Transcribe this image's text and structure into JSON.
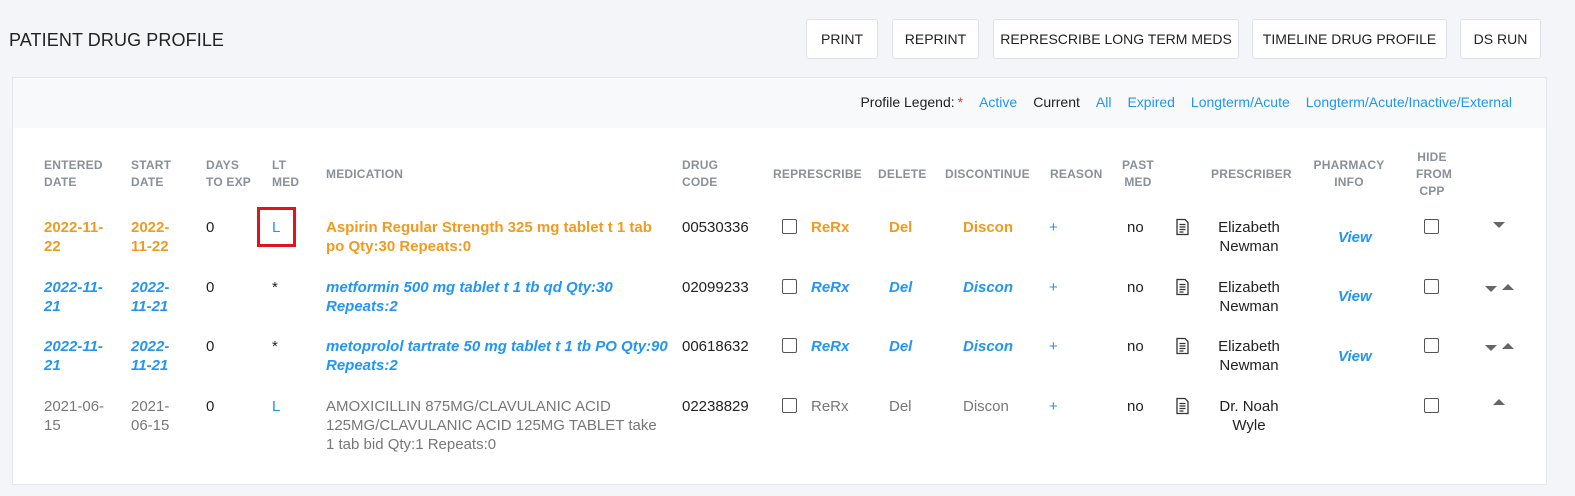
{
  "page": {
    "title": "PATIENT DRUG PROFILE"
  },
  "toolbar": {
    "print": "PRINT",
    "reprint": "REPRINT",
    "represcribe_long_term": "REPRESCRIBE LONG TERM MEDS",
    "timeline": "TIMELINE DRUG PROFILE",
    "ds_run": "DS RUN"
  },
  "legend": {
    "label": "Profile Legend:",
    "required_mark": "*",
    "options": [
      "Active",
      "Current",
      "All",
      "Expired",
      "Longterm/Acute",
      "Longterm/Acute/Inactive/External"
    ]
  },
  "columns": {
    "entered_1": "ENTERED",
    "entered_2": "DATE",
    "start_1": "START",
    "start_2": "DATE",
    "days_1": "DAYS",
    "days_2": "TO EXP",
    "lt_1": "LT",
    "lt_2": "MED",
    "medication": "MEDICATION",
    "drug_1": "DRUG",
    "drug_2": "CODE",
    "represcribe": "REPRESCRIBE",
    "delete": "DELETE",
    "discontinue": "DISCONTINUE",
    "reason": "REASON",
    "past_1": "PAST",
    "past_2": "MED",
    "prescriber": "PRESCRIBER",
    "pharmacy_1": "PHARMACY",
    "pharmacy_2": "INFO",
    "hide_1": "HIDE",
    "hide_2": "FROM",
    "hide_3": "CPP"
  },
  "rows": [
    {
      "entered_1": "2022-11-",
      "entered_2": "22",
      "start_1": "2022-",
      "start_2": "11-22",
      "days": "0",
      "lt": "L",
      "med_1": "Aspirin Regular Strength 325 mg tablet t 1 tab",
      "med_2": "po Qty:30 Repeats:0",
      "med_3": "",
      "drug_code": "00530336",
      "rerx": "ReRx",
      "del": "Del",
      "discon": "Discon",
      "reason": "+",
      "past": "no",
      "prescriber_1": "Elizabeth",
      "prescriber_2": "Newman",
      "pharmacy": "View"
    },
    {
      "entered_1": "2022-11-",
      "entered_2": "21",
      "start_1": "2022-",
      "start_2": "11-21",
      "days": "0",
      "lt": "*",
      "med_1": "metformin 500 mg tablet t 1 tb qd Qty:30",
      "med_2": "Repeats:2",
      "med_3": "",
      "drug_code": "02099233",
      "rerx": "ReRx",
      "del": "Del",
      "discon": "Discon",
      "reason": "+",
      "past": "no",
      "prescriber_1": "Elizabeth",
      "prescriber_2": "Newman",
      "pharmacy": "View"
    },
    {
      "entered_1": "2022-11-",
      "entered_2": "21",
      "start_1": "2022-",
      "start_2": "11-21",
      "days": "0",
      "lt": "*",
      "med_1": "metoprolol tartrate 50 mg tablet t 1 tb PO Qty:90",
      "med_2": "Repeats:2",
      "med_3": "",
      "drug_code": "00618632",
      "rerx": "ReRx",
      "del": "Del",
      "discon": "Discon",
      "reason": "+",
      "past": "no",
      "prescriber_1": "Elizabeth",
      "prescriber_2": "Newman",
      "pharmacy": "View"
    },
    {
      "entered_1": "2021-06-",
      "entered_2": "15",
      "start_1": "2021-",
      "start_2": "06-15",
      "days": "0",
      "lt": "L",
      "med_1": "AMOXICILLIN 875MG/CLAVULANIC ACID",
      "med_2": "125MG/CLAVULANIC ACID 125MG TABLET take",
      "med_3": "1 tab bid Qty:1 Repeats:0",
      "drug_code": "02238829",
      "rerx": "ReRx",
      "del": "Del",
      "discon": "Discon",
      "reason": "+",
      "past": "no",
      "prescriber_1": "Dr. Noah",
      "prescriber_2": "Wyle",
      "pharmacy": ""
    }
  ],
  "colors": {
    "accent": "#2196f3",
    "active": "#f39a1e",
    "highlight": "#e0131f"
  }
}
